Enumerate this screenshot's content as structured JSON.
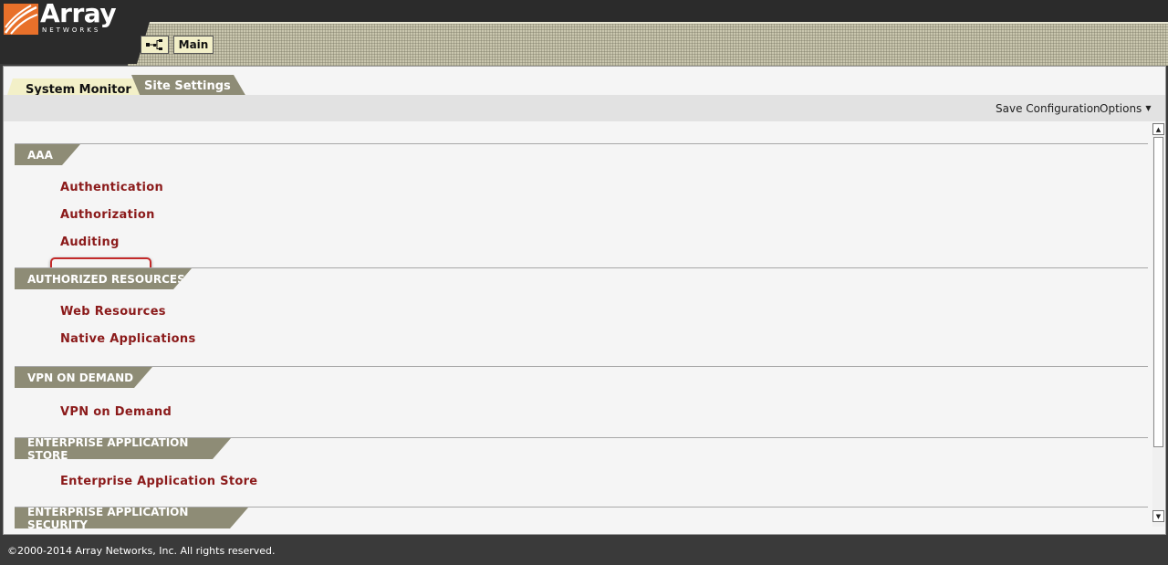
{
  "header": {
    "logo_text": "Array",
    "logo_subtext": "NETWORKS",
    "topology_icon": "network-topology-icon",
    "main_button": "Main"
  },
  "tabs": [
    {
      "label": "System Monitor"
    },
    {
      "label": "Site Settings"
    }
  ],
  "toolbar": {
    "save_configuration": "Save Configuration",
    "options": "Options",
    "options_caret_icon": "caret-down-icon"
  },
  "sections": [
    {
      "title": "AAA",
      "links": [
        "Authentication",
        "Authorization",
        "Auditing"
      ]
    },
    {
      "title": "AUTHORIZED RESOURCES",
      "links": [
        "Web Resources",
        "Native Applications"
      ]
    },
    {
      "title": "VPN ON DEMAND",
      "links": [
        "VPN on Demand"
      ]
    },
    {
      "title": "ENTERPRISE APPLICATION STORE",
      "links": [
        "Enterprise Application Store"
      ]
    },
    {
      "title": "ENTERPRISE APPLICATION SECURITY",
      "links": []
    }
  ],
  "footer": {
    "copyright": "©2000-2014 Array Networks, Inc. All rights reserved."
  },
  "colors": {
    "link": "#8b1a1a",
    "section_badge": "#8e8c76",
    "highlight_box": "#c32a2a",
    "logo_orange": "#e8702a"
  }
}
